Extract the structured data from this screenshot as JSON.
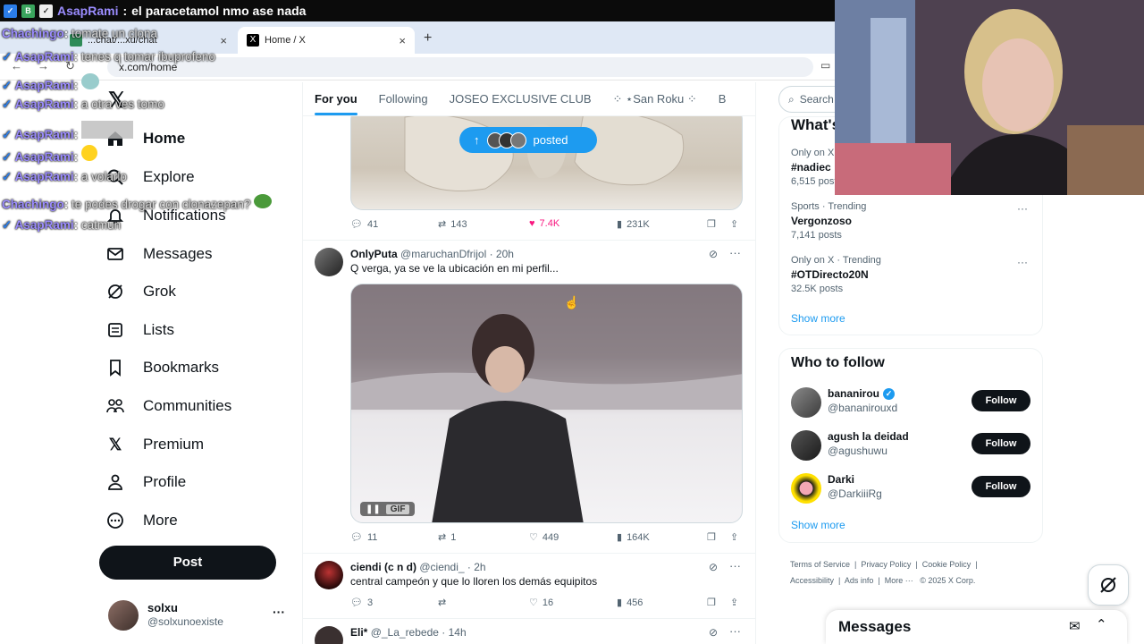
{
  "stream": {
    "top_user": "AsapRami",
    "top_message": "el paracetamol nmo ase nada",
    "chat": [
      {
        "user": "Chachingo",
        "message": "tomate un clona"
      },
      {
        "user": "AsapRami",
        "message": "tenes q tomar ibuprofeno"
      },
      {
        "user": "AsapRami",
        "message": ""
      },
      {
        "user": "AsapRami",
        "message": "a otra ves tomo"
      },
      {
        "user": "AsapRami",
        "message": ""
      },
      {
        "user": "AsapRami",
        "message": ""
      },
      {
        "user": "AsapRami",
        "message": "a volarlo"
      },
      {
        "user": "Chachingo",
        "message": "te podes drogar con clonazepan?"
      },
      {
        "user": "AsapRami",
        "message": "catmun"
      }
    ]
  },
  "browser": {
    "tabs": [
      {
        "label": "...chat/...xu/chat",
        "active": false
      },
      {
        "label": "Home / X",
        "active": true
      }
    ],
    "new_tab": "+",
    "url": "x.com/home"
  },
  "sidebar": {
    "items": [
      {
        "label": "Home",
        "icon": "home-icon"
      },
      {
        "label": "Explore",
        "icon": "search-icon"
      },
      {
        "label": "Notifications",
        "icon": "bell-icon"
      },
      {
        "label": "Messages",
        "icon": "mail-icon"
      },
      {
        "label": "Grok",
        "icon": "grok-icon"
      },
      {
        "label": "Lists",
        "icon": "list-icon"
      },
      {
        "label": "Bookmarks",
        "icon": "bookmark-icon"
      },
      {
        "label": "Communities",
        "icon": "communities-icon"
      },
      {
        "label": "Premium",
        "icon": "x-logo-icon"
      },
      {
        "label": "Profile",
        "icon": "person-icon"
      },
      {
        "label": "More",
        "icon": "more-icon"
      }
    ],
    "post_button": "Post",
    "account": {
      "name": "solxu",
      "handle": "@solxunoexiste",
      "more": "···"
    }
  },
  "feed": {
    "tabs": [
      "For you",
      "Following",
      "JOSEO EXCLUSIVE CLUB",
      "⁘ ⋆San Roku ⁘",
      "B"
    ],
    "posted_pill": "posted",
    "tweets": [
      {
        "name": "",
        "handle": "",
        "time": "",
        "text": "",
        "replies": "41",
        "reposts": "143",
        "likes": "7.4K",
        "views": "231K",
        "liked": true
      },
      {
        "name": "OnlyPuta",
        "handle": "@maruchanDfrijol",
        "time": "20h",
        "text": "Q verga, ya se ve la ubicación en mi perfil...",
        "gif_label": "GIF",
        "replies": "11",
        "reposts": "1",
        "likes": "449",
        "views": "164K"
      },
      {
        "name": "ciendi (c n d)",
        "handle": "@ciendi_",
        "time": "2h",
        "text": "central campeón y que lo lloren los demás equipitos",
        "replies": "3",
        "reposts": "",
        "likes": "16",
        "views": "456"
      },
      {
        "name": "Eli*",
        "handle": "@_La_rebede",
        "time": "14h",
        "text": ""
      }
    ]
  },
  "right": {
    "search_placeholder": "Search",
    "trends_title": "What's happening",
    "trends": [
      {
        "meta": "Only on X · Trending",
        "name": "#nadiec",
        "posts": "6,515 posts"
      },
      {
        "meta": "Sports · Trending",
        "name": "Vergonzoso",
        "posts": "7,141 posts"
      },
      {
        "meta": "Only on X · Trending",
        "name": "#OTDirecto20N",
        "posts": "32.5K posts"
      }
    ],
    "show_more": "Show more",
    "who_to_follow": "Who to follow",
    "suggestions": [
      {
        "name": "bananirou",
        "handle": "@bananirouxd",
        "verified": true,
        "button": "Follow"
      },
      {
        "name": "agush la deidad",
        "handle": "@agushuwu",
        "verified": false,
        "button": "Follow"
      },
      {
        "name": "Darki",
        "handle": "@DarkiiiRg",
        "verified": false,
        "button": "Follow"
      }
    ],
    "footer": [
      "Terms of Service",
      "Privacy Policy",
      "Cookie Policy",
      "Accessibility",
      "Ads info",
      "More ···",
      "© 2025 X Corp."
    ],
    "messages_drawer": "Messages"
  },
  "colors": {
    "accent": "#1d9bf0",
    "like": "#f91880",
    "chat_name": "#9b8cff"
  }
}
